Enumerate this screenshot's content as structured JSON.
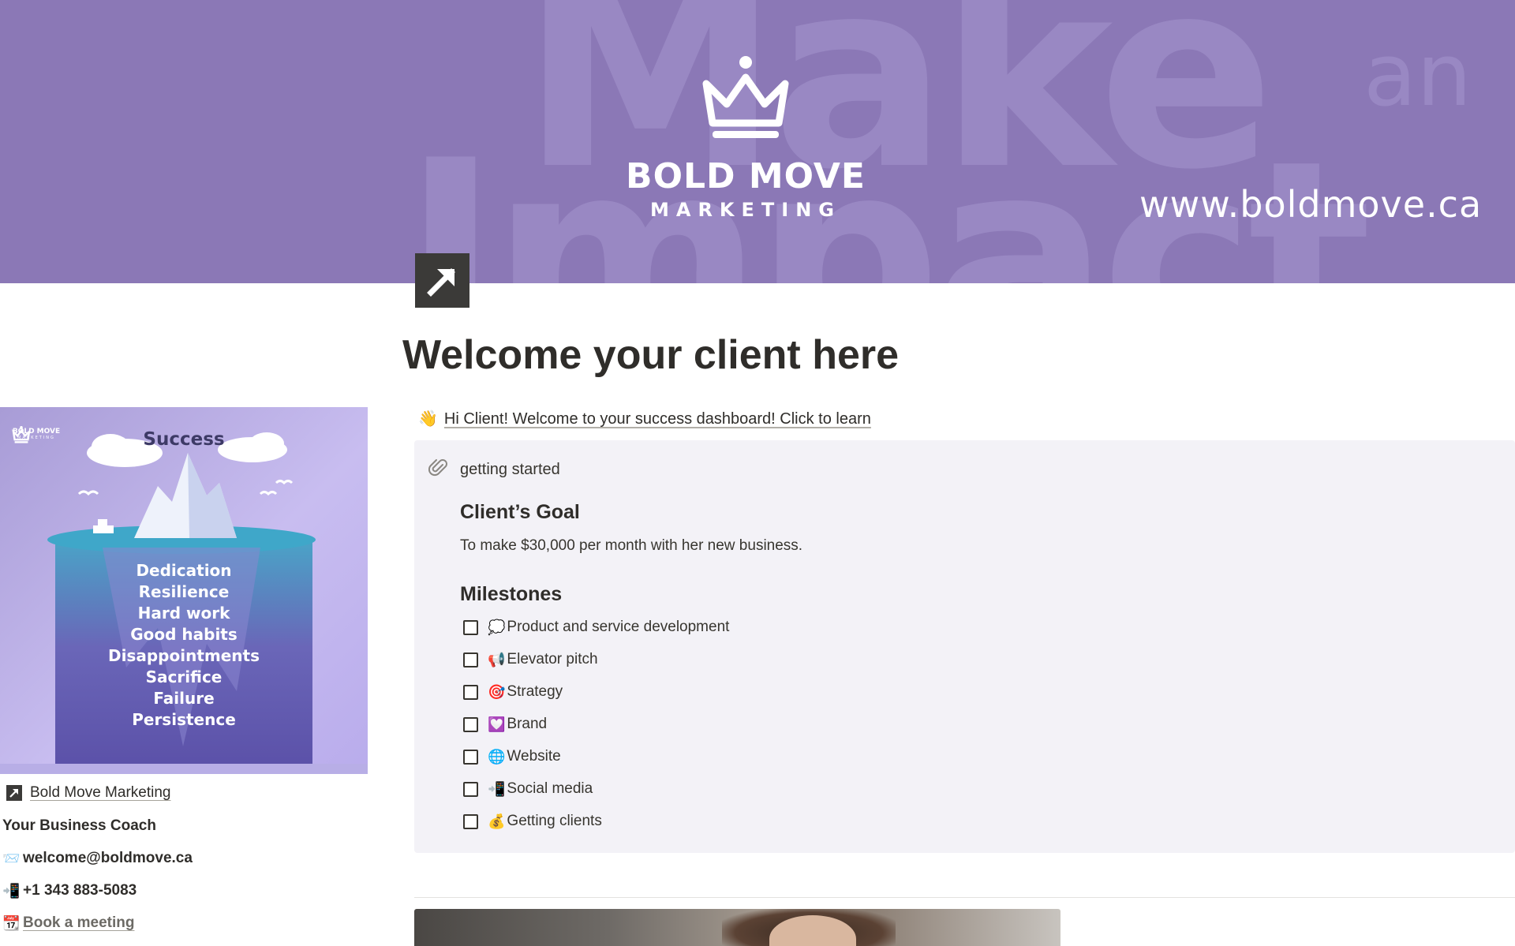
{
  "colors": {
    "cover_background": "#8b78b6",
    "callout_background": "#f3f2f7",
    "text": "#37352f",
    "icon_background": "#3b3a38"
  },
  "cover": {
    "background_words": [
      "Make",
      "an",
      "Impact"
    ],
    "brand_name": "BOLD MOVE",
    "brand_sub": "MARKETING",
    "website": "www.boldmove.ca"
  },
  "page": {
    "icon": "arrow-up-right-icon",
    "title": "Welcome your client here"
  },
  "sidebar": {
    "poster": {
      "logo_name": "BOLD MOVE",
      "logo_sub": "MARKETING",
      "title": "Success",
      "words": [
        "Dedication",
        "Resilience",
        "Hard work",
        "Good habits",
        "Disappointments",
        "Sacrifice",
        "Failure",
        "Persistence"
      ]
    },
    "company_link": "Bold Move Marketing",
    "coach_label": "Your Business Coach",
    "email_emoji": "📨",
    "email": "welcome@boldmove.ca",
    "phone_emoji": "📲",
    "phone": "+1 343 883-5083",
    "meeting_emoji": "📆",
    "meeting_link": "Book a meeting"
  },
  "intro": {
    "emoji": "👋",
    "text": "Hi Client! Welcome to your success dashboard! Click to learn"
  },
  "callout": {
    "icon": "paperclip-icon",
    "title": "getting started",
    "goal_heading": "Client’s Goal",
    "goal_text": "To make $30,000 per month with her new business.",
    "milestones_heading": "Milestones",
    "milestones": [
      {
        "emoji": "💭",
        "label": " Product and service development",
        "checked": false
      },
      {
        "emoji": "📢",
        "label": "Elevator pitch",
        "checked": false
      },
      {
        "emoji": "🎯",
        "label": "Strategy",
        "checked": false
      },
      {
        "emoji": "💟",
        "label": "Brand",
        "checked": false
      },
      {
        "emoji": "🌐",
        "label": "Website",
        "checked": false
      },
      {
        "emoji": "📲",
        "label": "Social media",
        "checked": false
      },
      {
        "emoji": "💰",
        "label": "Getting clients",
        "checked": false
      }
    ]
  }
}
